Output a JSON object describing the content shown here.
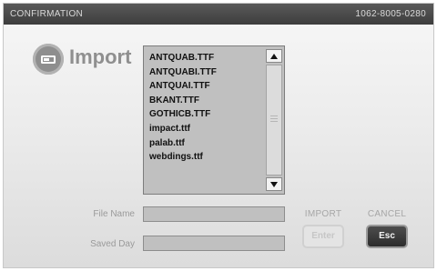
{
  "header": {
    "title": "CONFIRMATION",
    "code": "1062-8005-0280"
  },
  "import_heading": "Import",
  "icon": "import-icon",
  "files": [
    "ANTQUAB.TTF",
    "ANTQUABI.TTF",
    "ANTQUAI.TTF",
    "BKANT.TTF",
    "GOTHICB.TTF",
    "impact.ttf",
    "palab.ttf",
    "webdings.ttf"
  ],
  "fields": {
    "file_name_label": "File Name",
    "file_name_value": "",
    "saved_day_label": "Saved Day",
    "saved_day_value": ""
  },
  "buttons": {
    "import_caption": "IMPORT",
    "import_label": "Enter",
    "cancel_caption": "CANCEL",
    "cancel_label": "Esc"
  },
  "colors": {
    "title_bar": "#444444",
    "list_background": "#c0c0c0",
    "cancel_button": "#333333",
    "disabled_text": "#c6c6c6"
  }
}
